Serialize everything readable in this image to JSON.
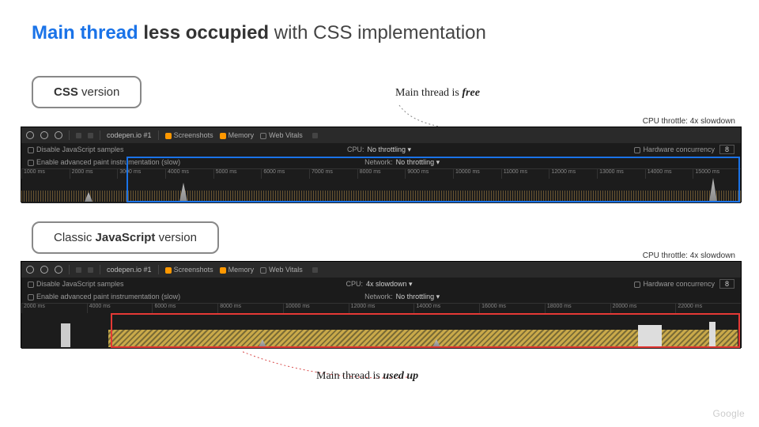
{
  "title": {
    "blue": "Main thread",
    "bold": "less occupied",
    "rest": " with CSS implementation"
  },
  "css_panel": {
    "label_prefix": "",
    "label_strong": "CSS",
    "label_suffix": " version",
    "throttle": "CPU throttle: 4x slowdown",
    "toolbar": {
      "tab": "codepen.io #1",
      "screenshots": "Screenshots",
      "memory": "Memory",
      "webvitals": "Web Vitals"
    },
    "row1": {
      "disable": "Disable JavaScript samples",
      "cpu_label": "CPU:",
      "cpu_value": "No throttling",
      "hw_label": "Hardware concurrency",
      "hw_value": "8"
    },
    "row2": {
      "advpaint": "Enable advanced paint instrumentation (slow)",
      "net_label": "Network:",
      "net_value": "No throttling"
    },
    "ticks": [
      "1000 ms",
      "2000 ms",
      "3000 ms",
      "4000 ms",
      "5000 ms",
      "6000 ms",
      "7000 ms",
      "8000 ms",
      "9000 ms",
      "10000 ms",
      "11000 ms",
      "12000 ms",
      "13000 ms",
      "14000 ms",
      "15000 ms"
    ]
  },
  "js_panel": {
    "label_prefix": "Classic ",
    "label_strong": "JavaScript",
    "label_suffix": " version",
    "throttle": "CPU throttle: 4x slowdown",
    "toolbar": {
      "tab": "codepen.io #1",
      "screenshots": "Screenshots",
      "memory": "Memory",
      "webvitals": "Web Vitals"
    },
    "row1": {
      "disable": "Disable JavaScript samples",
      "cpu_label": "CPU:",
      "cpu_value": "4x slowdown",
      "hw_label": "Hardware concurrency",
      "hw_value": "8"
    },
    "row2": {
      "advpaint": "Enable advanced paint instrumentation (slow)",
      "net_label": "Network:",
      "net_value": "No throttling"
    },
    "ticks": [
      "2000 ms",
      "4000 ms",
      "6000 ms",
      "8000 ms",
      "10000 ms",
      "12000 ms",
      "14000 ms",
      "16000 ms",
      "18000 ms",
      "20000 ms",
      "22000 ms"
    ]
  },
  "annotations": {
    "free_prefix": "Main thread is ",
    "free_word": "free",
    "used_prefix": "Main thread is ",
    "used_word": "used up"
  },
  "logo": "Google"
}
